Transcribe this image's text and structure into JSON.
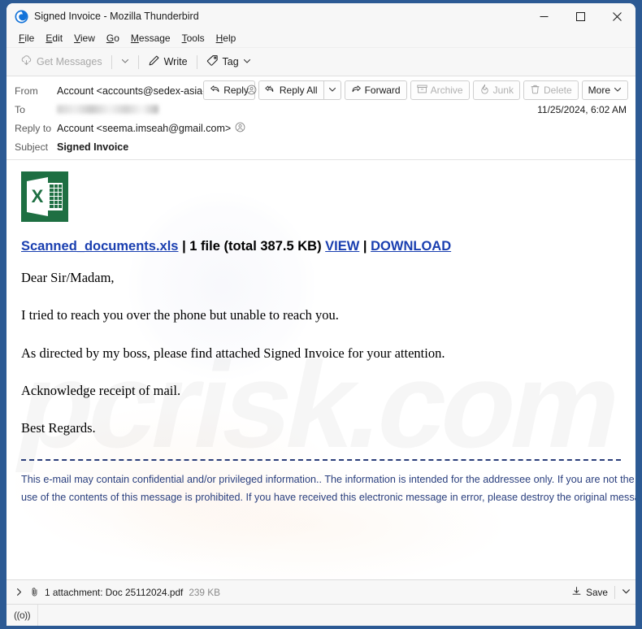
{
  "window": {
    "title": "Signed Invoice - Mozilla Thunderbird",
    "logo_icon": "thunderbird-logo-icon",
    "minimize_icon": "minimize-icon",
    "maximize_icon": "maximize-icon",
    "close_icon": "close-icon"
  },
  "menubar": {
    "items": [
      {
        "label": "File",
        "accel": "F"
      },
      {
        "label": "Edit",
        "accel": "E"
      },
      {
        "label": "View",
        "accel": "V"
      },
      {
        "label": "Go",
        "accel": "G"
      },
      {
        "label": "Message",
        "accel": "M"
      },
      {
        "label": "Tools",
        "accel": "T"
      },
      {
        "label": "Help",
        "accel": "H"
      }
    ]
  },
  "toolbar": {
    "get_messages_label": "Get Messages",
    "write_label": "Write",
    "tag_label": "Tag"
  },
  "header": {
    "from_label": "From",
    "from_value": "Account <accounts@sedex-asia-th.com>",
    "to_label": "To",
    "to_value_redacted": "",
    "reply_to_label": "Reply to",
    "reply_to_value": "Account <seema.imseah@gmail.com>",
    "subject_label": "Subject",
    "subject_value": "Signed Invoice",
    "date": "11/25/2024, 6:02 AM",
    "actions": {
      "reply": "Reply",
      "reply_all": "Reply All",
      "forward": "Forward",
      "archive": "Archive",
      "junk": "Junk",
      "delete": "Delete",
      "more": "More"
    }
  },
  "body": {
    "watermark_text": "pcrisk.com",
    "attachment_icon": "excel-file-icon",
    "attachment_link": "Scanned_documents.xls",
    "attachment_meta": " | 1 file (total 387.5 KB) ",
    "view_link": "VIEW",
    "separator": " | ",
    "download_link": "DOWNLOAD",
    "paragraphs": [
      "Dear Sir/Madam,",
      "I tried to reach you over the phone but unable to reach you.",
      "As directed by my boss, please find attached Signed Invoice for your attention.",
      "Acknowledge receipt of mail.",
      "Best Regards."
    ],
    "disclaimer": "This e-mail may contain confidential and/or privileged information.. The information is intended for the addressee only. If you are not the addressee, any disclosure, copy, distribution or use of the contents of this message is prohibited. If you have received this electronic message in error, please destroy the original message and all copies."
  },
  "attachment_bar": {
    "expand_icon": "chevron-right-icon",
    "clip_icon": "paperclip-icon",
    "label": "1 attachment: Doc 25112024.pdf",
    "size": "239 KB",
    "save_label": "Save",
    "save_icon": "download-icon",
    "dropdown_icon": "chevron-down-icon"
  },
  "statusbar": {
    "icon": "broadcast-icon",
    "icon_glyph": "((o))"
  },
  "colors": {
    "window_frame": "#2c5a94",
    "link_blue": "#1a3fb0",
    "disclaimer_blue": "#2a3f7e",
    "excel_green": "#1e6f42",
    "chrome_gray": "#f7f7f7"
  }
}
